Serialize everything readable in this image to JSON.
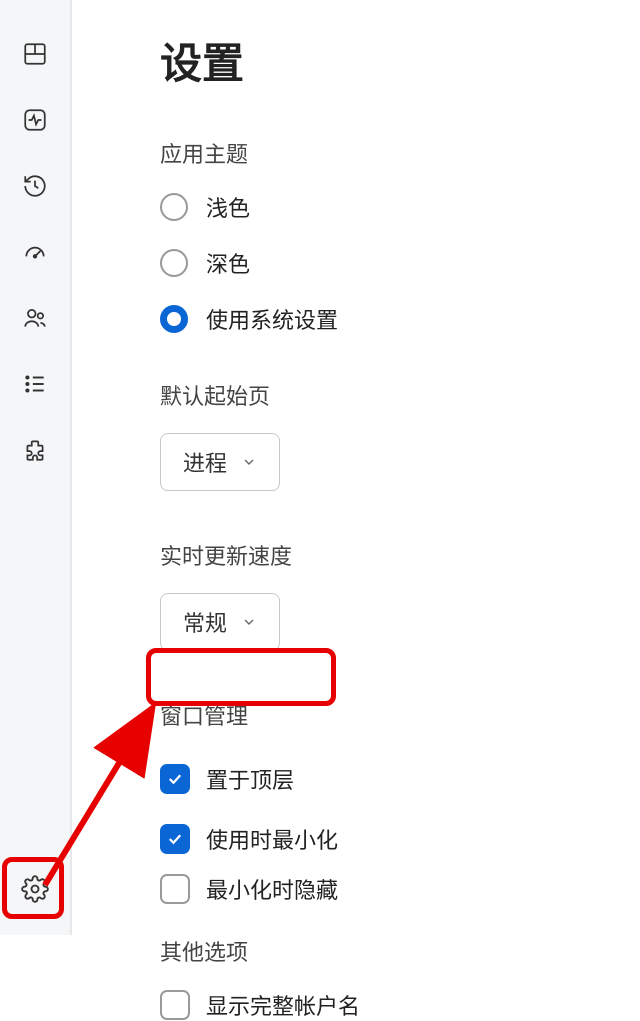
{
  "page": {
    "title": "设置"
  },
  "sections": {
    "theme": {
      "label": "应用主题",
      "options": {
        "light": "浅色",
        "dark": "深色",
        "system": "使用系统设置"
      },
      "selected": "system"
    },
    "start_page": {
      "label": "默认起始页",
      "value": "进程"
    },
    "update_speed": {
      "label": "实时更新速度",
      "value": "常规"
    },
    "window_mgmt": {
      "label": "窗口管理",
      "items": {
        "always_on_top": {
          "label": "置于顶层",
          "checked": true
        },
        "minimize_on_use": {
          "label": "使用时最小化",
          "checked": true
        },
        "hide_when_minimized": {
          "label": "最小化时隐藏",
          "checked": false
        }
      }
    },
    "other": {
      "label": "其他选项",
      "items": {
        "show_full_account": {
          "label": "显示完整帐户名",
          "checked": false
        }
      }
    }
  },
  "colors": {
    "accent": "#0a66d5",
    "annotation": "#e60000"
  }
}
